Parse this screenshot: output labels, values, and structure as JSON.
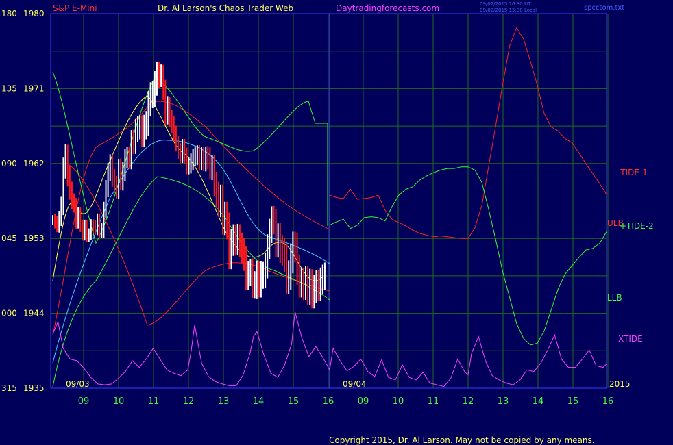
{
  "header": {
    "instrument": "S&P E-Mini",
    "author": "Dr. Al Larson's Chaos Trader Web",
    "site": "Daytradingforecasts.com",
    "ut_stamp": "09/02/2015 20:30 UT",
    "local_stamp": "09/02/2015 15:30 Local",
    "file": "spcctom.txt"
  },
  "footer": {
    "copyright": "Copyright 2015, Dr. Al Larson. May not be copied by any means."
  },
  "colors": {
    "background": "#00005a",
    "plot_frame": "#3b3bff",
    "grid": "#1d6b1d",
    "price_up": "#ffffff",
    "price_down": "#ff1a1a",
    "red_lines": "#ff2020",
    "green_lines": "#30ff30",
    "cyan_line": "#40d0ff",
    "yellow_line": "#ffff40",
    "magenta_line": "#ff40ff",
    "left_axis": "#ffff60",
    "bottom_axis": "#40ff40"
  },
  "chart_data": {
    "type": "line",
    "ylim": [
      1935,
      1980
    ],
    "y_ticks": [
      {
        "left": "180",
        "right": "1980",
        "value": 1980
      },
      {
        "left": "135",
        "right": "1971",
        "value": 1971
      },
      {
        "left": "090",
        "right": "1962",
        "value": 1962
      },
      {
        "left": "045",
        "right": "1953",
        "value": 1953
      },
      {
        "left": "000",
        "right": "1944",
        "value": 1944
      },
      {
        "left": "315",
        "right": "1935",
        "value": 1935
      }
    ],
    "x_ticks": [
      "09",
      "10",
      "11",
      "12",
      "13",
      "14",
      "15",
      "16",
      "09",
      "10",
      "11",
      "12",
      "13",
      "14",
      "15",
      "16"
    ],
    "day_labels": [
      "09/03",
      "09/04",
      "2015"
    ],
    "series_labels": [
      {
        "name": "-TIDE-1",
        "color": "#ff3030"
      },
      {
        "name": "ULB",
        "color": "#ff3030"
      },
      {
        "name": "+TIDE-2",
        "color": "#40ff40"
      },
      {
        "name": "LLB",
        "color": "#40ff40"
      },
      {
        "name": "XTIDE",
        "color": "#ff40ff"
      }
    ],
    "price_series": {
      "x_start": 8.3,
      "x_step": 0.05,
      "closes": [
        1955.2,
        1954.9,
        1954.5,
        1955.5,
        1957.0,
        1961.5,
        1963.0,
        1960.5,
        1958.8,
        1957.5,
        1957.0,
        1955.0,
        1956.0,
        1954.5,
        1953.5,
        1954.5,
        1953.3,
        1953.5,
        1954.6,
        1954.4,
        1954.2,
        1955.2,
        1953.9,
        1954.0,
        1956.5,
        1959.0,
        1961.0,
        1962.0,
        1960.3,
        1959.5,
        1958.8,
        1961.5,
        1959.9,
        1961.0,
        1962.6,
        1962.8,
        1962.6,
        1964.7,
        1964.5,
        1966.0,
        1966.3,
        1966.4,
        1965.4,
        1966.4,
        1966.8,
        1969.2,
        1970.2,
        1970.3,
        1971.6,
        1972.8,
        1972.5,
        1972.6,
        1970.9,
        1967.8,
        1969.0,
        1967.4,
        1966.7,
        1965.6,
        1964.4,
        1963.5,
        1963.0,
        1964.0,
        1962.9,
        1961.7,
        1961.8,
        1962.2,
        1962.7,
        1962.9,
        1963.1,
        1962.3,
        1962.8,
        1962.3,
        1962.8,
        1962.6,
        1961.4,
        1961.6,
        1959.5,
        1958.3,
        1957.1,
        1957.9,
        1955.0,
        1955.8,
        1954.5,
        1950.9,
        1952.5,
        1953.1,
        1952.5,
        1953.2,
        1952.2,
        1951.5,
        1950.6,
        1948.3,
        1948.8,
        1949.0,
        1947.4,
        1947.4,
        1948.6,
        1947.6,
        1948.6,
        1948.6,
        1949.7,
        1952.0,
        1953.9,
        1955.4,
        1955.0,
        1952.3,
        1953.2,
        1951.7,
        1951.4,
        1950.6,
        1948.1,
        1948.6,
        1950.6,
        1952.0,
        1951.9,
        1949.2,
        1947.7,
        1947.7,
        1947.4,
        1947.9,
        1946.7,
        1947.6,
        1946.3,
        1946.9,
        1947.5,
        1947.1,
        1947.9,
        1948.3,
        1948.6
      ],
      "ranges": [
        1.2,
        1.4,
        1.5,
        1.6,
        2.0,
        2.4,
        2.6,
        2.5,
        2.3,
        2.0,
        1.8,
        1.7,
        1.6,
        1.5,
        1.5,
        1.5,
        1.4,
        1.4,
        1.4,
        1.4,
        1.5,
        1.6,
        1.6,
        1.7,
        1.8,
        2.0,
        2.1,
        2.2,
        2.2,
        2.1,
        2.0,
        2.1,
        2.2,
        2.3,
        2.3,
        2.4,
        2.5,
        2.6,
        2.7,
        2.7,
        2.8,
        2.8,
        2.8,
        2.9,
        3.0,
        3.0,
        3.1,
        3.1,
        3.0,
        2.9,
        2.8,
        2.6,
        2.5,
        2.3,
        2.2,
        2.1,
        2.0,
        1.9,
        1.9,
        1.9,
        1.9,
        1.9,
        1.9,
        2.0,
        2.0,
        2.0,
        2.1,
        2.1,
        2.2,
        2.2,
        2.3,
        2.4,
        2.5,
        2.6,
        2.7,
        2.8,
        2.9,
        3.0,
        3.0,
        3.1,
        3.1,
        3.2,
        3.2,
        3.2,
        3.2,
        3.2,
        3.1,
        3.1,
        3.0,
        3.0,
        3.0,
        3.0,
        3.0,
        3.1,
        3.2,
        3.3,
        3.4,
        3.4,
        3.4,
        3.3,
        3.2,
        3.0,
        2.9,
        2.9,
        3.0,
        3.1,
        3.2,
        3.3,
        3.4,
        3.4,
        3.5,
        3.5,
        3.6,
        3.6,
        3.6,
        3.6,
        3.6,
        3.6,
        3.6,
        3.6,
        3.5,
        3.5,
        3.4,
        3.4,
        3.3,
        3.3,
        3.2,
        3.1,
        3.0
      ]
    },
    "series": [
      {
        "key": "tide1",
        "color": "#ff2020",
        "x": [
          16.0,
          16.2,
          16.4,
          16.6,
          16.8,
          17.0,
          17.2,
          17.4,
          17.6,
          17.8,
          18.0,
          18.2,
          18.4,
          18.6,
          18.8,
          19.0,
          19.2,
          19.4,
          19.6,
          19.8,
          20.0,
          20.2,
          20.4,
          20.6,
          20.8,
          21.0,
          21.2,
          21.4,
          21.6,
          21.8,
          22.0,
          22.2,
          22.4,
          22.6,
          22.8,
          23.0,
          23.2,
          23.4,
          23.6,
          23.8,
          24.0
        ],
        "y": [
          1958.2,
          1957.9,
          1957.8,
          1958.9,
          1957.7,
          1957.8,
          1957.9,
          1958.2,
          1956.4,
          1955.3,
          1954.9,
          1954.5,
          1954.0,
          1953.6,
          1953.4,
          1953.2,
          1953.3,
          1953.2,
          1953.1,
          1953.0,
          1953.0,
          1954.3,
          1957.0,
          1961.8,
          1966.6,
          1971.5,
          1976.1,
          1978.3,
          1977.0,
          1974.3,
          1971.4,
          1968.0,
          1966.4,
          1965.9,
          1965.0,
          1964.5,
          1963.3,
          1962.0,
          1960.8,
          1959.6,
          1958.3
        ]
      },
      {
        "key": "tide2",
        "color": "#30ff30",
        "x": [
          16.0,
          16.2,
          16.4,
          16.6,
          16.8,
          17.0,
          17.2,
          17.4,
          17.6,
          17.8,
          18.0,
          18.2,
          18.4,
          18.6,
          18.8,
          19.0,
          19.2,
          19.4,
          19.6,
          19.8,
          20.0,
          20.2,
          20.4,
          20.6,
          20.8,
          21.0,
          21.2,
          21.4,
          21.6,
          21.8,
          22.0,
          22.2,
          22.4,
          22.6,
          22.8,
          23.0,
          23.2,
          23.4,
          23.6,
          23.8,
          24.0
        ],
        "y": [
          1954.6,
          1955.0,
          1955.3,
          1954.2,
          1954.6,
          1955.5,
          1955.6,
          1955.5,
          1955.1,
          1956.8,
          1958.2,
          1958.9,
          1959.2,
          1960.0,
          1960.5,
          1960.9,
          1961.2,
          1961.4,
          1961.4,
          1961.6,
          1961.6,
          1961.2,
          1959.7,
          1956.4,
          1952.8,
          1949.0,
          1945.9,
          1942.8,
          1941.0,
          1940.2,
          1940.4,
          1941.9,
          1944.4,
          1946.9,
          1948.7,
          1949.7,
          1950.7,
          1951.6,
          1951.8,
          1952.4,
          1953.8
        ]
      },
      {
        "key": "xtide",
        "color": "#ff40ff",
        "x": [
          8.0,
          8.15,
          8.3,
          8.5,
          8.7,
          8.9,
          9.1,
          9.3,
          9.5,
          9.7,
          9.9,
          10.1,
          10.3,
          10.5,
          10.7,
          10.9,
          11.1,
          11.3,
          11.5,
          11.7,
          11.9,
          12.0,
          12.1,
          12.3,
          12.5,
          12.7,
          12.9,
          13.1,
          13.3,
          13.5,
          13.7,
          13.8,
          13.9,
          14.1,
          14.3,
          14.5,
          14.7,
          14.9,
          15.0,
          15.2,
          15.4,
          15.6,
          15.8,
          16.0,
          16.1,
          16.3,
          16.5,
          16.7,
          16.9,
          17.1,
          17.3,
          17.5,
          17.7,
          17.9,
          18.1,
          18.3,
          18.5,
          18.7,
          18.9,
          19.1,
          19.3,
          19.5,
          19.7,
          19.9,
          20.0,
          20.1,
          20.3,
          20.5,
          20.7,
          20.9,
          21.1,
          21.3,
          21.5,
          21.7,
          21.9,
          22.1,
          22.3,
          22.5,
          22.7,
          22.9,
          23.1,
          23.3,
          23.5,
          23.7,
          23.9,
          24.0
        ],
        "y": [
          1941.5,
          1943.0,
          1939.8,
          1938.5,
          1938.3,
          1937.4,
          1936.3,
          1935.5,
          1935.4,
          1935.5,
          1936.2,
          1937.0,
          1938.3,
          1937.5,
          1938.5,
          1939.8,
          1938.5,
          1937.2,
          1936.8,
          1936.5,
          1937.2,
          1939.5,
          1942.6,
          1938.0,
          1936.4,
          1935.8,
          1935.5,
          1935.3,
          1935.3,
          1936.6,
          1939.2,
          1941.2,
          1941.8,
          1939.0,
          1936.8,
          1936.3,
          1937.8,
          1940.3,
          1944.2,
          1941.0,
          1938.8,
          1940.0,
          1938.7,
          1937.2,
          1939.8,
          1938.3,
          1937.1,
          1937.6,
          1938.5,
          1937.0,
          1936.4,
          1938.4,
          1936.3,
          1936.0,
          1937.8,
          1936.3,
          1936.0,
          1936.9,
          1935.6,
          1935.4,
          1935.2,
          1936.2,
          1938.5,
          1937.0,
          1936.6,
          1939.2,
          1941.2,
          1938.3,
          1936.5,
          1936.0,
          1935.6,
          1935.4,
          1936.0,
          1937.2,
          1937.0,
          1938.0,
          1939.6,
          1941.4,
          1938.5,
          1937.5,
          1937.5,
          1938.5,
          1939.6,
          1937.7,
          1937.5,
          1937.9
        ]
      }
    ]
  }
}
